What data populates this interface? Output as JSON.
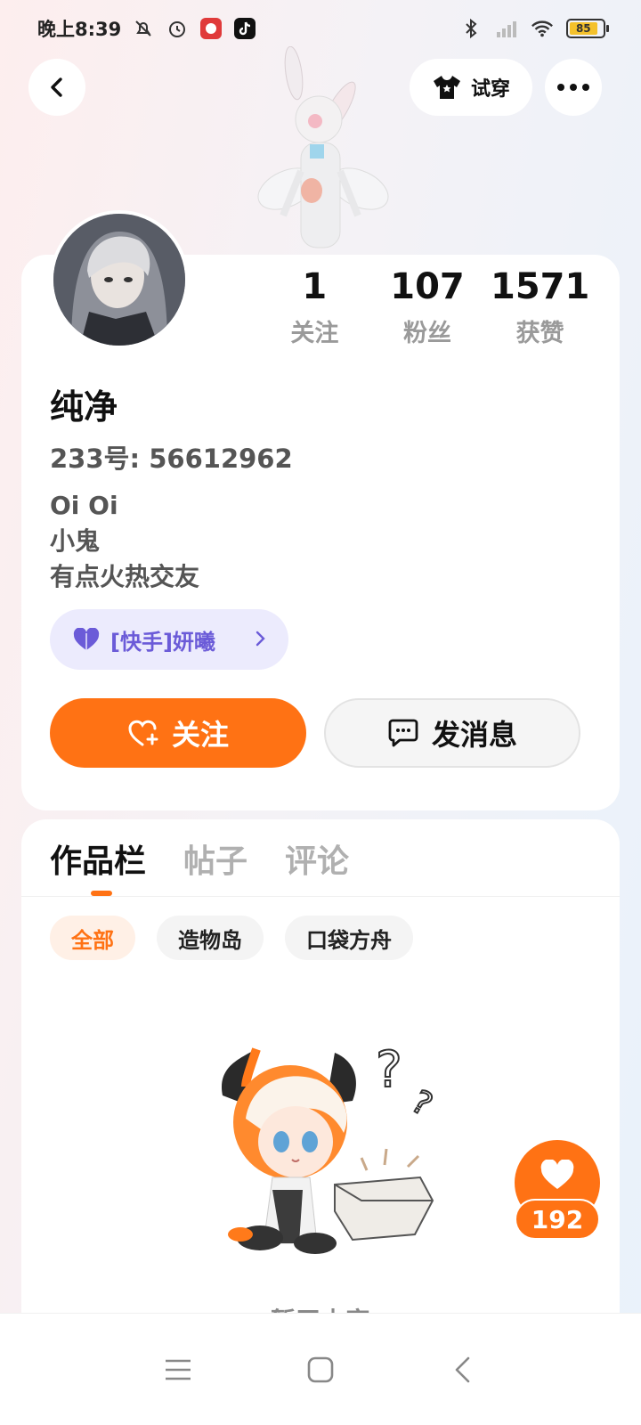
{
  "status_bar": {
    "time": "晚上8:39",
    "battery": "85"
  },
  "top_nav": {
    "try_on_label": "试穿"
  },
  "profile": {
    "stats": [
      {
        "value": "1",
        "label": "关注"
      },
      {
        "value": "107",
        "label": "粉丝"
      },
      {
        "value": "1571",
        "label": "获赞"
      }
    ],
    "name": "纯净",
    "uid": "233号: 56612962",
    "bio": [
      "Oi Oi",
      "小鬼",
      "有点火热交友"
    ],
    "fan_badge": "[快手]妍曦",
    "follow_label": "关注",
    "message_label": "发消息"
  },
  "content": {
    "tabs": [
      "作品栏",
      "帖子",
      "评论"
    ],
    "filters": [
      "全部",
      "造物岛",
      "口袋方舟"
    ],
    "empty_text": "暂无内容"
  },
  "like_float": {
    "count": "192"
  },
  "colors": {
    "accent": "#ff7214",
    "badge_text": "#6b5bd8",
    "badge_bg": "#ecebfd"
  }
}
